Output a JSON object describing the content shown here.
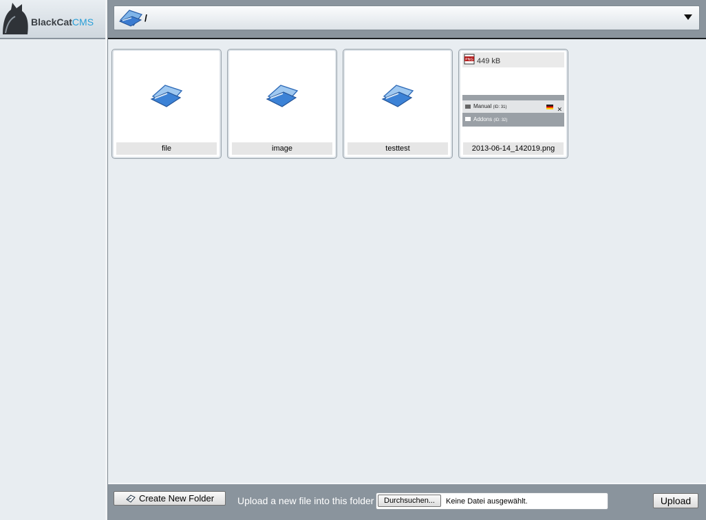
{
  "app": {
    "logo_name": "BlackCat",
    "logo_suffix": "CMS"
  },
  "pathbar": {
    "path": "/"
  },
  "tiles": [
    {
      "type": "folder",
      "label": "file"
    },
    {
      "type": "folder",
      "label": "image"
    },
    {
      "type": "folder",
      "label": "testtest"
    },
    {
      "type": "file",
      "label": "2013-06-14_142019.png",
      "size": "449 kB",
      "icon": "png-file-icon"
    }
  ],
  "preview": {
    "row1_text": "Manual",
    "row1_id": "(ID: 31)",
    "row2_text": "Addons",
    "row2_id": "(ID: 32)"
  },
  "bottombar": {
    "create_folder_label": "Create New Folder",
    "upload_text": "Upload a new file into this folder",
    "browse_label": "Durchsuchen...",
    "file_status": "Keine Datei ausgewählt.",
    "upload_label": "Upload"
  },
  "colors": {
    "background": "#8a949d",
    "panel": "#e8edf1",
    "accent": "#2a9fd8"
  }
}
